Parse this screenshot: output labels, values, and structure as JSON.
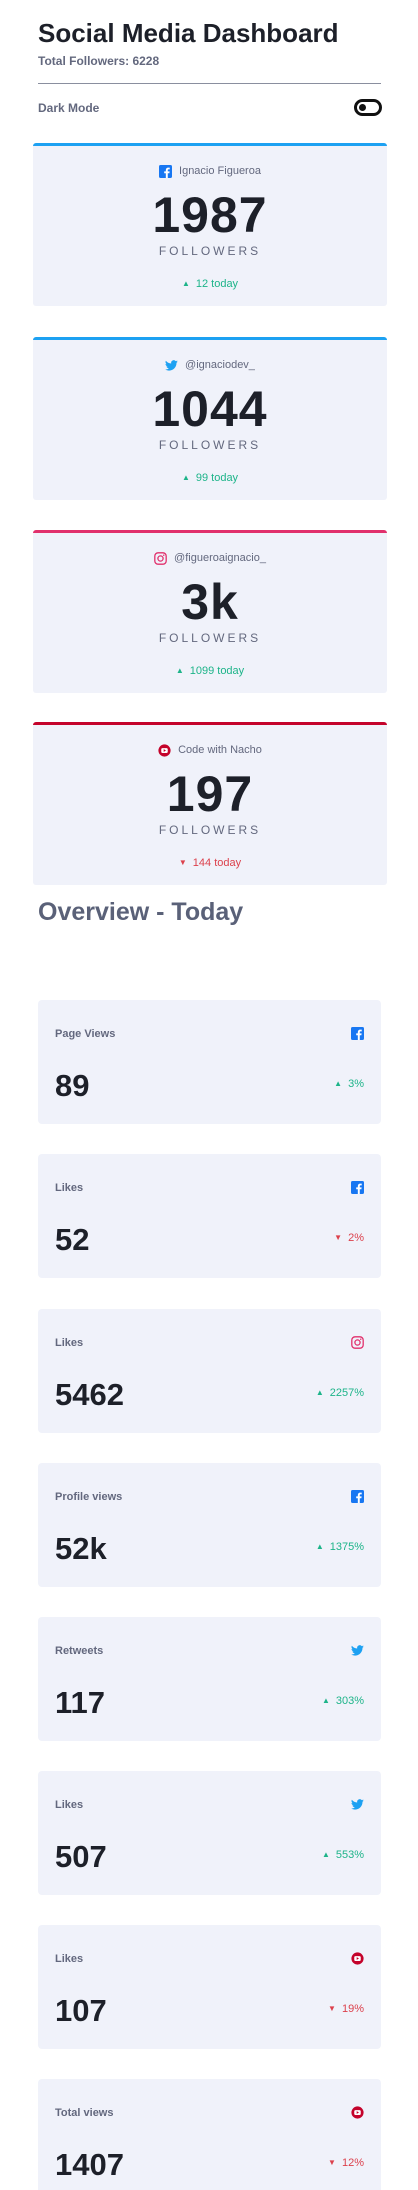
{
  "header": {
    "title": "Social Media Dashboard",
    "total_followers": "Total Followers: 6228",
    "dark_mode_label": "Dark Mode"
  },
  "follower_cards": [
    {
      "platform_icon": "facebook-icon",
      "handle": "Ignacio Figueroa",
      "count": "1987",
      "label": "FOLLOWERS",
      "today": "12 today",
      "trend": "up",
      "accent": "#1da1f2"
    },
    {
      "platform_icon": "twitter-icon",
      "handle": "@ignaciodev_",
      "count": "1044",
      "label": "FOLLOWERS",
      "today": "99 today",
      "trend": "up",
      "accent": "#1da1f2"
    },
    {
      "platform_icon": "instagram-icon",
      "handle": "@figueroaignacio_",
      "count": "3k",
      "label": "FOLLOWERS",
      "today": "1099 today",
      "trend": "up",
      "accent": "#e1306c"
    },
    {
      "platform_icon": "youtube-icon",
      "handle": "Code with Nacho",
      "count": "197",
      "label": "FOLLOWERS",
      "today": "144 today",
      "trend": "down",
      "accent": "#c4032b"
    }
  ],
  "overview": {
    "title": "Overview - Today",
    "cards": [
      {
        "metric": "Page Views",
        "platform_icon": "facebook-icon",
        "value": "89",
        "percent": "3%",
        "trend": "up"
      },
      {
        "metric": "Likes",
        "platform_icon": "facebook-icon",
        "value": "52",
        "percent": "2%",
        "trend": "down"
      },
      {
        "metric": "Likes",
        "platform_icon": "instagram-icon",
        "value": "5462",
        "percent": "2257%",
        "trend": "up"
      },
      {
        "metric": "Profile views",
        "platform_icon": "facebook-icon",
        "value": "52k",
        "percent": "1375%",
        "trend": "up"
      },
      {
        "metric": "Retweets",
        "platform_icon": "twitter-icon",
        "value": "117",
        "percent": "303%",
        "trend": "up"
      },
      {
        "metric": "Likes",
        "platform_icon": "twitter-icon",
        "value": "507",
        "percent": "553%",
        "trend": "up"
      },
      {
        "metric": "Likes",
        "platform_icon": "youtube-icon",
        "value": "107",
        "percent": "19%",
        "trend": "down"
      },
      {
        "metric": "Total views",
        "platform_icon": "youtube-icon",
        "value": "1407",
        "percent": "12%",
        "trend": "down"
      }
    ]
  },
  "colors": {
    "up": "#1db489",
    "down": "#dc414c",
    "facebook": "#1877f2",
    "twitter": "#1da1f2",
    "instagram": "#e1306c",
    "youtube": "#c4032b"
  }
}
